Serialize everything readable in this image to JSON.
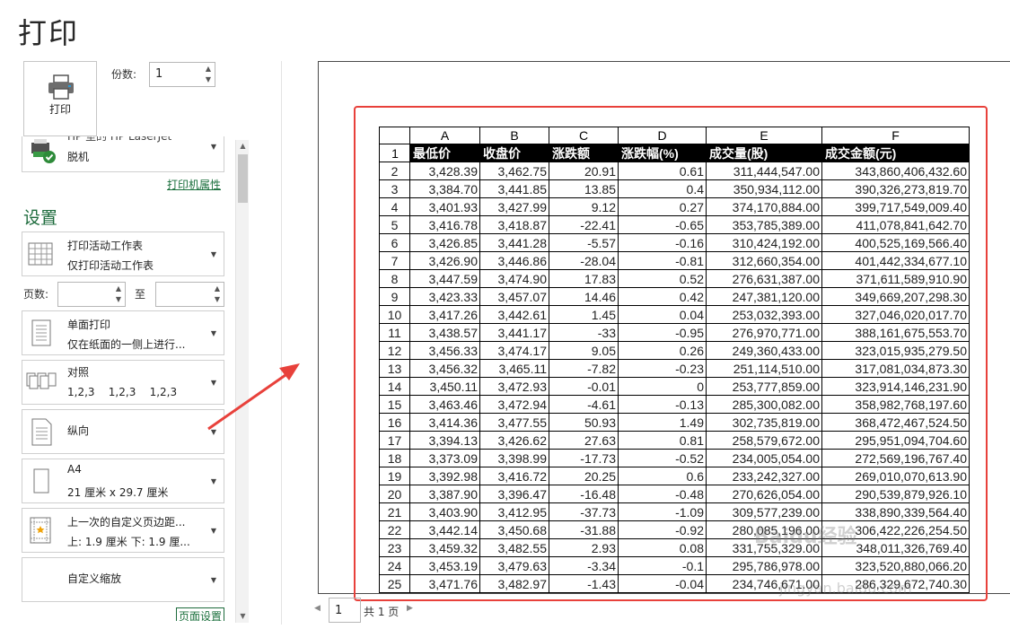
{
  "page": {
    "title": "打印"
  },
  "print": {
    "button_label": "打印",
    "copies_label": "份数:",
    "copies_value": "1"
  },
  "printer": {
    "name_partial": "HP 室的 HP LaserJet",
    "status": "脱机",
    "properties_link": "打印机属性"
  },
  "settings": {
    "heading": "设置",
    "what": {
      "l1": "打印活动工作表",
      "l2": "仅打印活动工作表"
    },
    "pages_label": "页数:",
    "to_label": "至",
    "sides": {
      "l1": "单面打印",
      "l2": "仅在纸面的一侧上进行..."
    },
    "collate": {
      "l1": "对照",
      "l2": "1,2,3    1,2,3    1,2,3"
    },
    "orientation": {
      "l1": "纵向"
    },
    "paper": {
      "l1": "A4",
      "l2": "21 厘米 x 29.7 厘米"
    },
    "margins": {
      "l1": "上一次的自定义页边距...",
      "l2": "上: 1.9 厘米 下: 1.9 厘..."
    },
    "scaling": {
      "l1": "自定义缩放"
    },
    "page_setup_link": "页面设置"
  },
  "pager": {
    "current": "1",
    "total": "共 1 页"
  },
  "watermark": {
    "main": "Baidu经验",
    "url": "jingyan.baidu.com"
  },
  "sheet": {
    "columns": [
      "A",
      "B",
      "C",
      "D",
      "E",
      "F"
    ],
    "header_row": [
      "最低价",
      "收盘价",
      "涨跌额",
      "涨跌幅(%)",
      "成交量(股)",
      "成交金额(元)"
    ],
    "rows": [
      [
        "3,428.39",
        "3,462.75",
        "20.91",
        "0.61",
        "311,444,547.00",
        "343,860,406,432.60"
      ],
      [
        "3,384.70",
        "3,441.85",
        "13.85",
        "0.4",
        "350,934,112.00",
        "390,326,273,819.70"
      ],
      [
        "3,401.93",
        "3,427.99",
        "9.12",
        "0.27",
        "374,170,884.00",
        "399,717,549,009.40"
      ],
      [
        "3,416.78",
        "3,418.87",
        "-22.41",
        "-0.65",
        "353,785,389.00",
        "411,078,841,642.70"
      ],
      [
        "3,426.85",
        "3,441.28",
        "-5.57",
        "-0.16",
        "310,424,192.00",
        "400,525,169,566.40"
      ],
      [
        "3,426.90",
        "3,446.86",
        "-28.04",
        "-0.81",
        "312,660,354.00",
        "401,442,334,677.10"
      ],
      [
        "3,447.59",
        "3,474.90",
        "17.83",
        "0.52",
        "276,631,387.00",
        "371,611,589,910.90"
      ],
      [
        "3,423.33",
        "3,457.07",
        "14.46",
        "0.42",
        "247,381,120.00",
        "349,669,207,298.30"
      ],
      [
        "3,417.26",
        "3,442.61",
        "1.45",
        "0.04",
        "253,032,393.00",
        "327,046,020,017.70"
      ],
      [
        "3,438.57",
        "3,441.17",
        "-33",
        "-0.95",
        "276,970,771.00",
        "388,161,675,553.70"
      ],
      [
        "3,456.33",
        "3,474.17",
        "9.05",
        "0.26",
        "249,360,433.00",
        "323,015,935,279.50"
      ],
      [
        "3,456.32",
        "3,465.11",
        "-7.82",
        "-0.23",
        "251,114,510.00",
        "317,081,034,873.30"
      ],
      [
        "3,450.11",
        "3,472.93",
        "-0.01",
        "0",
        "253,777,859.00",
        "323,914,146,231.90"
      ],
      [
        "3,463.46",
        "3,472.94",
        "-4.61",
        "-0.13",
        "285,300,082.00",
        "358,982,768,197.60"
      ],
      [
        "3,414.36",
        "3,477.55",
        "50.93",
        "1.49",
        "302,735,819.00",
        "368,472,467,524.50"
      ],
      [
        "3,394.13",
        "3,426.62",
        "27.63",
        "0.81",
        "258,579,672.00",
        "295,951,094,704.60"
      ],
      [
        "3,373.09",
        "3,398.99",
        "-17.73",
        "-0.52",
        "234,005,054.00",
        "272,569,196,767.40"
      ],
      [
        "3,392.98",
        "3,416.72",
        "20.25",
        "0.6",
        "233,242,327.00",
        "269,010,070,613.90"
      ],
      [
        "3,387.90",
        "3,396.47",
        "-16.48",
        "-0.48",
        "270,626,054.00",
        "290,539,879,926.10"
      ],
      [
        "3,403.90",
        "3,412.95",
        "-37.73",
        "-1.09",
        "309,577,239.00",
        "338,890,339,564.40"
      ],
      [
        "3,442.14",
        "3,450.68",
        "-31.88",
        "-0.92",
        "280,085,196.00",
        "306,422,226,254.50"
      ],
      [
        "3,459.32",
        "3,482.55",
        "2.93",
        "0.08",
        "331,755,329.00",
        "348,011,326,769.40"
      ],
      [
        "3,453.19",
        "3,479.63",
        "-3.34",
        "-0.1",
        "295,786,978.00",
        "323,520,880,066.20"
      ],
      [
        "3,471.76",
        "3,482.97",
        "-1.43",
        "-0.04",
        "234,746,671.00",
        "286,329,672,740.30"
      ]
    ]
  },
  "colors": {
    "accent": "#1d6b3c",
    "highlight": "#e8413b"
  }
}
